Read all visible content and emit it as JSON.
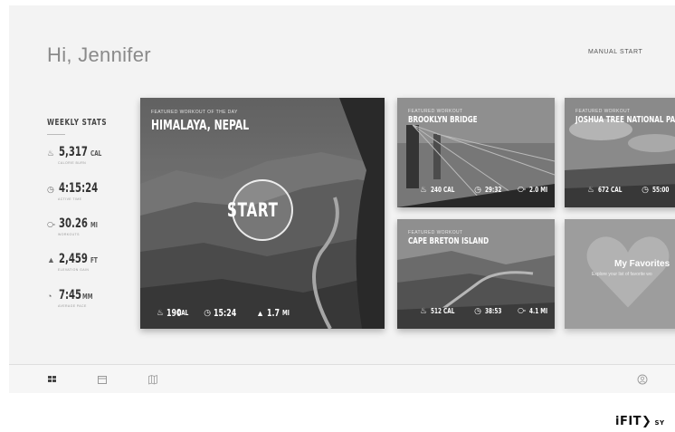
{
  "greeting": "Hi, Jennifer",
  "manual_start": "MANUAL START",
  "weekly_stats": {
    "title": "WEEKLY STATS",
    "items": [
      {
        "icon": "flame-icon",
        "value": "5,317",
        "unit": "CAL",
        "label": "CALORIE BURN"
      },
      {
        "icon": "stopwatch-icon",
        "value": "4:15:24",
        "unit": "",
        "label": "ACTIVE TIME"
      },
      {
        "icon": "route-icon",
        "value": "30.26",
        "unit": "MI",
        "label": "WORKOUTS"
      },
      {
        "icon": "mountain-icon",
        "value": "2,459",
        "unit": "FT",
        "label": "ELEVATION GAIN"
      },
      {
        "icon": "pace-icon",
        "value": "7:45",
        "unit": "MM",
        "label": "AVERAGE PACE"
      }
    ]
  },
  "featured_day": {
    "kicker": "FEATURED WORKOUT OF THE DAY",
    "title": "HIMALAYA, NEPAL",
    "start_label": "START",
    "calories": "190",
    "cal_unit": "CAL",
    "time": "15:24",
    "distance": "1.7",
    "dist_unit": "MI"
  },
  "cards": [
    {
      "kicker": "FEATURED WORKOUT",
      "title": "BROOKLYN BRIDGE",
      "calories": "240 CAL",
      "time": "29:32",
      "distance": "2.0 MI"
    },
    {
      "kicker": "FEATURED WORKOUT",
      "title": "JOSHUA TREE NATIONAL PARK",
      "calories": "672 CAL",
      "time": "55:00"
    },
    {
      "kicker": "FEATURED WORKOUT",
      "title": "CAPE BRETON ISLAND",
      "calories": "512 CAL",
      "time": "38:53",
      "distance": "4.1 MI"
    }
  ],
  "favorites": {
    "title": "My Favorites",
    "subtitle": "Explore your list of favorite wo"
  },
  "logo": {
    "text": "iFIT",
    "suffix": "SY"
  }
}
